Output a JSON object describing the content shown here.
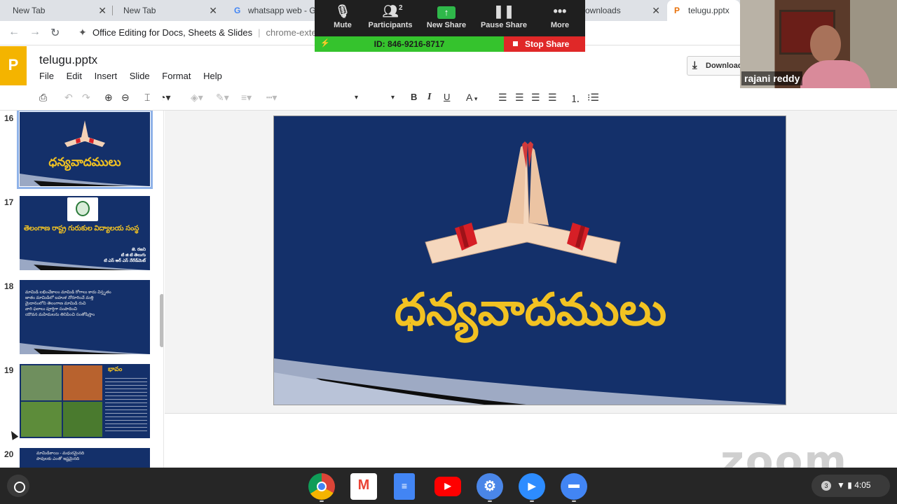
{
  "browser": {
    "tabs": [
      {
        "label": "New Tab"
      },
      {
        "label": "New Tab"
      },
      {
        "label": "whatsapp web - G"
      },
      {
        "label": "ownloads"
      },
      {
        "label": "telugu.pptx"
      }
    ],
    "omnibox_title": "Office Editing for Docs, Sheets & Slides",
    "omnibox_url": "chrome-exten"
  },
  "app": {
    "logo_letter": "P",
    "doc_title": "telugu.pptx",
    "menu": [
      "File",
      "Edit",
      "Insert",
      "Slide",
      "Format",
      "Help"
    ],
    "download_label": "Download"
  },
  "toolbar": {
    "bold": "B",
    "italic": "I",
    "underline": "U",
    "font_color": "A"
  },
  "filmstrip": {
    "slides": [
      {
        "number": "16",
        "title": "ధన్యవాదములు"
      },
      {
        "number": "17",
        "title": "తెలంగాణ రాష్ట్ర గురుకుల విద్యాలయ సంస్థ",
        "lines": [
          "జె. రజని",
          "టి జి టి తెలుగు",
          "టి ఎస్ ఆర్ ఎస్ నేరేడ్‌మెట్"
        ]
      },
      {
        "number": "18",
        "lines": [
          "మామిడి లభించేకాలం మామిడి రోగాలు కాదు విస్తృతం",
          "జాతం మామిడిలో బహుళ నోరూరించే మత్తి",
          "మైదానంలోని తెలంగాణ మామిడి రుచి",
          "వారి ఫలాలు పూర్తిగా సంపాదించి",
          "యౌవన మహిమలను తినిపించి సంతోషిస్తాం"
        ]
      },
      {
        "number": "19",
        "title": "భావం"
      },
      {
        "number": "20",
        "lines": [
          "మామిడికాయి - మధురమైనది",
          "పావులకు ఎంతో ఇష్టమైనది"
        ]
      }
    ]
  },
  "slide": {
    "title": "ధన్యవాదములు"
  },
  "zoom": {
    "buttons": [
      {
        "label": "Mute"
      },
      {
        "label": "Participants",
        "count": "2"
      },
      {
        "label": "New Share"
      },
      {
        "label": "Pause Share"
      },
      {
        "label": "More"
      }
    ],
    "meeting_id": "ID: 846-9216-8717",
    "stop_share": "Stop Share",
    "participant_name": "rajani reddy",
    "watermark": "zoom"
  },
  "shelf": {
    "status_badge": "3",
    "time": "4:05"
  },
  "colors": {
    "slide_bg": "#14306a",
    "slide_title": "#f2c222",
    "stop_share": "#e02828",
    "meeting_id_bg": "#35c32d"
  }
}
